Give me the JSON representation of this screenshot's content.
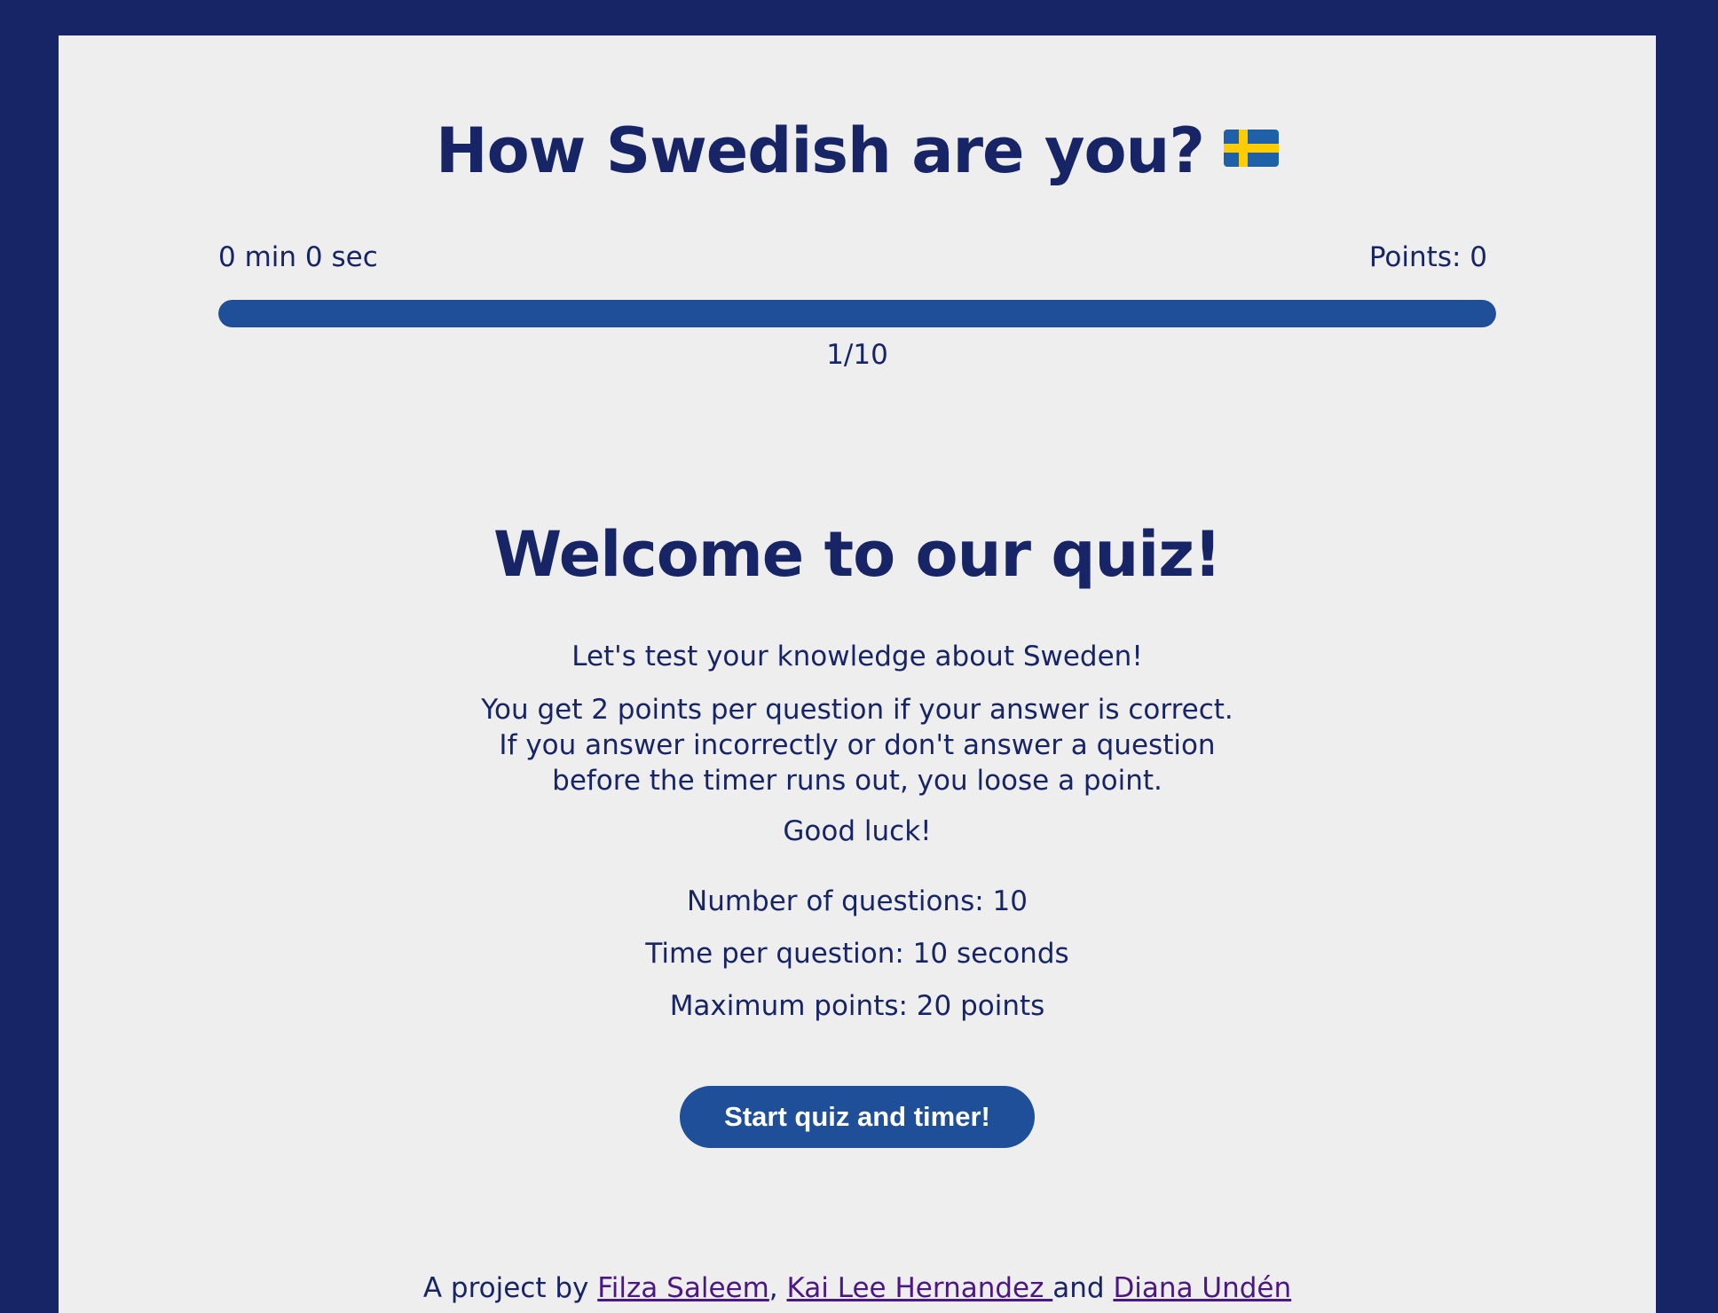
{
  "header": {
    "title": "How Swedish are you?",
    "flag_icon": "swedish-flag"
  },
  "status": {
    "timer": "0 min 0 sec",
    "points": "Points: 0"
  },
  "progress": {
    "counter": "1/10",
    "fraction": 1.0
  },
  "welcome": {
    "heading": "Welcome to our quiz!",
    "intro": "Let's test your knowledge about Sweden!",
    "rules_line1": "You get 2 points per question if your answer is correct.",
    "rules_line2": "If you answer incorrectly or don't answer a question",
    "rules_line3": "before the timer runs out, you loose a point.",
    "good_luck": "Good luck!",
    "num_questions": "Number of questions: 10",
    "time_per_question": "Time per question: 10 seconds",
    "max_points": "Maximum points: 20 points",
    "start_button": "Start quiz and timer!"
  },
  "footer": {
    "prefix": "A project by ",
    "author1": "Filza Saleem",
    "separator": ", ",
    "author2": "Kai Lee Hernandez ",
    "conjunction": "and ",
    "author3": "Diana Undén"
  },
  "colors": {
    "background": "#172566",
    "page": "#eeeeee",
    "accent": "#1e4f98",
    "text": "#172566",
    "link": "#4b1784"
  }
}
